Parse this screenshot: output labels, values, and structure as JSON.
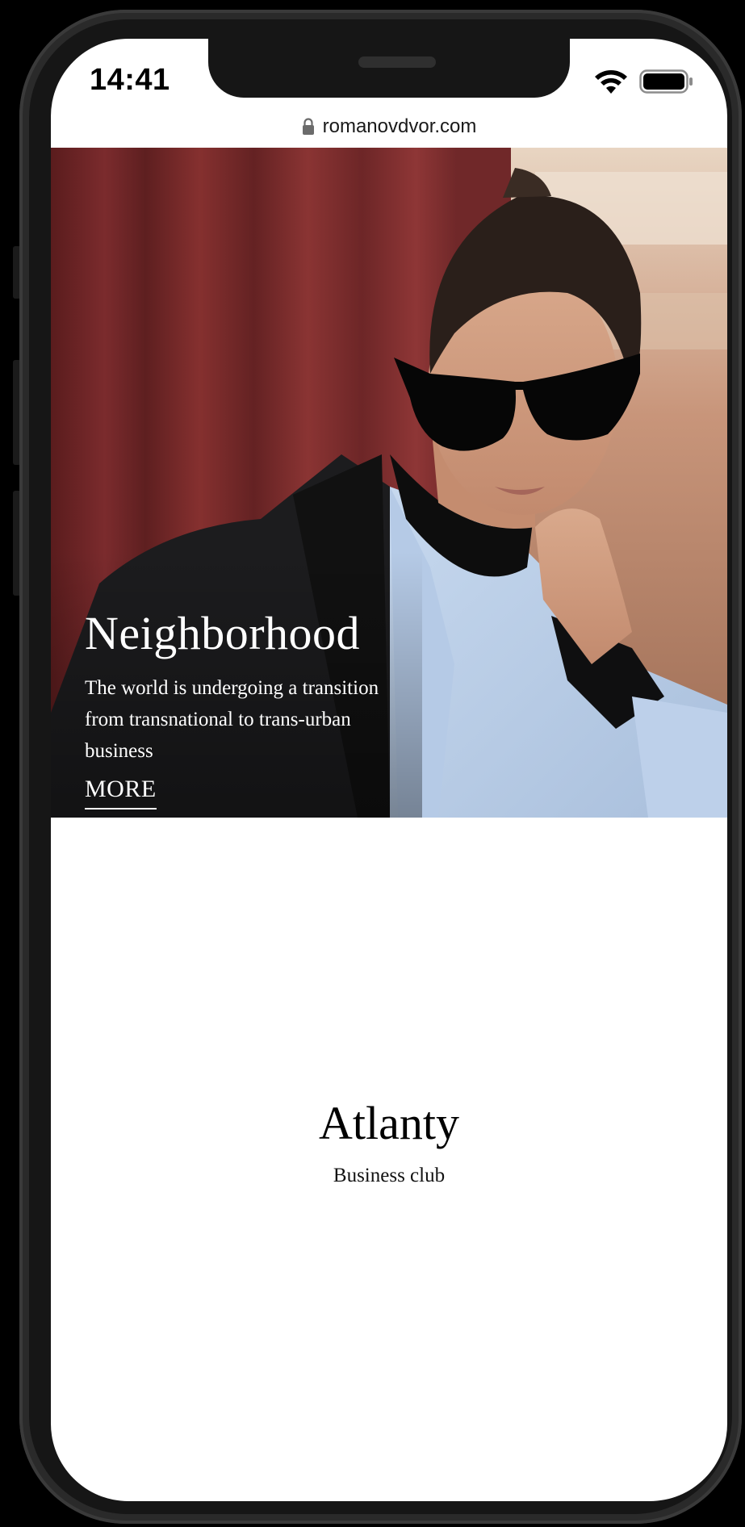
{
  "status_bar": {
    "time": "14:41",
    "icons": [
      "wifi-icon",
      "battery-icon"
    ]
  },
  "browser": {
    "url": "romanovdvor.com",
    "icon": "lock-icon"
  },
  "hero": {
    "title": "Neighborhood",
    "description": "The world is undergoing a transition from transnational to trans-urban business",
    "more_label": "MORE"
  },
  "brand": {
    "title": "Atlanty",
    "subtitle": "Business club"
  },
  "colors": {
    "background": "#ffffff",
    "frame": "#161616",
    "curtain": "#7a2a2c",
    "text_dark": "#000000",
    "text_light": "#ffffff"
  }
}
